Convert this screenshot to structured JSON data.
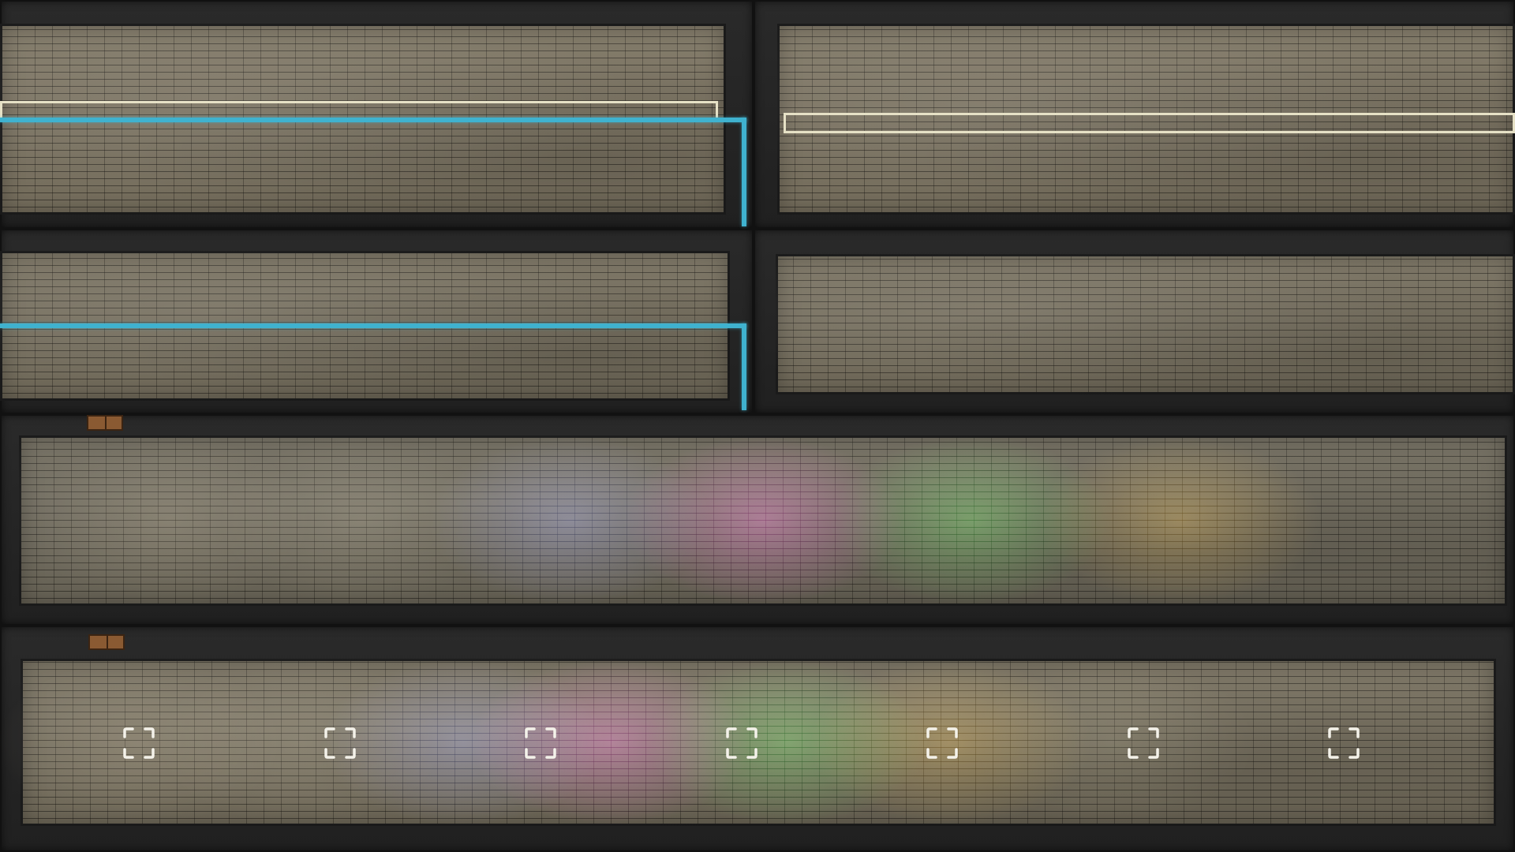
{
  "scene": {
    "type": "top-down colony base view",
    "wall_color": "#202020",
    "floor_color": "#7d7563",
    "wire_color": "#3fb2cf",
    "outline_color": "#e6e1c6",
    "door_color": "#8a5a32"
  },
  "rooms": [
    {
      "name": "room-top-left",
      "icon": "brick-floor"
    },
    {
      "name": "room-top-right",
      "icon": "brick-floor"
    },
    {
      "name": "room-mid-left",
      "icon": "brick-floor"
    },
    {
      "name": "room-mid-right",
      "icon": "brick-floor"
    },
    {
      "name": "room-rainbow-upper",
      "icon": "brick-floor"
    },
    {
      "name": "room-rainbow-lower",
      "icon": "brick-floor"
    }
  ],
  "light_colors": [
    "#b8a27c",
    "#c4b48c",
    "#6b74c8",
    "#d23aa8",
    "#2fb82f",
    "#d89a1e",
    "#a0a080"
  ],
  "build_slots": [
    {
      "icon": "selection-bracket-icon"
    },
    {
      "icon": "selection-bracket-icon"
    },
    {
      "icon": "selection-bracket-icon"
    },
    {
      "icon": "selection-bracket-icon"
    },
    {
      "icon": "selection-bracket-icon"
    },
    {
      "icon": "selection-bracket-icon"
    },
    {
      "icon": "selection-bracket-icon"
    }
  ]
}
